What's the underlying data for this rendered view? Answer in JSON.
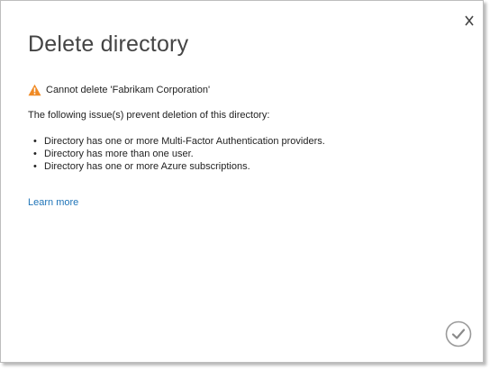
{
  "dialog": {
    "title": "Delete directory",
    "warning_text": "Cannot delete 'Fabrikam Corporation'",
    "issues_heading": "The following issue(s) prevent deletion of this directory:",
    "issues": [
      "Directory has one or more Multi-Factor Authentication providers.",
      "Directory has more than one user.",
      "Directory has one or more Azure subscriptions."
    ],
    "bullet": "•",
    "learn_more_label": "Learn more"
  },
  "icons": {
    "close": "close-icon",
    "warning": "warning-icon",
    "confirm": "checkmark-icon"
  },
  "colors": {
    "warning": "#f08a24",
    "link": "#1f74b8",
    "title": "#444444",
    "text": "#222222",
    "confirm_border": "#9a9a9a"
  }
}
